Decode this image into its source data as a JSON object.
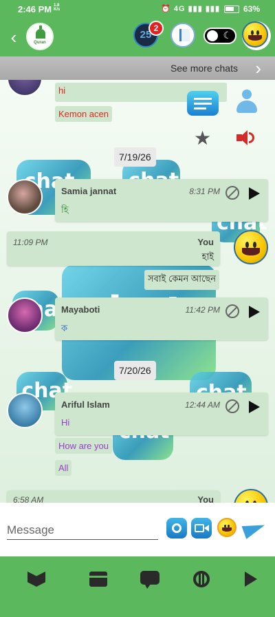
{
  "status_bar": {
    "time": "2:46 PM",
    "net_speed_top": "1.8",
    "net_speed_bottom": "K/s",
    "icons": "⏰ 4G ▮▮▮ ▮▮▮",
    "battery": "63%"
  },
  "top_bar": {
    "logo_text": "Quran",
    "badge_count": "2",
    "counter_text": "25",
    "toggle_icon": "☾"
  },
  "see_more": {
    "label": "See more chats"
  },
  "messages": [
    {
      "text": "hi"
    },
    {
      "text": "Kemon acen"
    },
    {
      "date": "7/19/26"
    },
    {
      "name": "Samia jannat",
      "time": "8:31 PM",
      "text": "হি"
    },
    {
      "name": "You",
      "time": "11:09 PM",
      "text": "হাই"
    },
    {
      "text": "সবাই কেমন আছেন"
    },
    {
      "name": "Mayaboti",
      "time": "11:42 PM",
      "text": "ক"
    },
    {
      "date": "7/20/26"
    },
    {
      "name": "Ariful Islam",
      "time": "12:44 AM",
      "text": "Hi"
    },
    {
      "text": "How are you"
    },
    {
      "text": "All"
    },
    {
      "name": "You",
      "time": "6:58 AM"
    }
  ],
  "input": {
    "placeholder": "Message"
  },
  "colors": {
    "primary": "#5cb85c",
    "bubble": "#cde6cd",
    "purple_text": "#9a3cc8",
    "red_text": "#e0261f"
  }
}
